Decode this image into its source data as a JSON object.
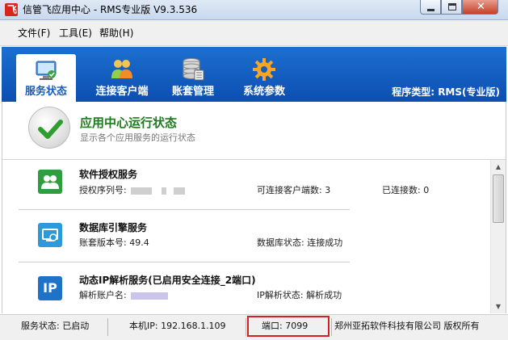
{
  "window": {
    "title": "信管飞应用中心 - RMS专业版 V9.3.536",
    "icon": "app-logo-icon",
    "close_label": "✕"
  },
  "menu": [
    {
      "label": "文件(F)"
    },
    {
      "label": "工具(E)"
    },
    {
      "label": "帮助(H)"
    }
  ],
  "nav": {
    "tabs": [
      {
        "label": "服务状态",
        "icon": "monitor-icon",
        "active": true
      },
      {
        "label": "连接客户端",
        "icon": "users-icon",
        "active": false
      },
      {
        "label": "账套管理",
        "icon": "database-icon",
        "active": false
      },
      {
        "label": "系统参数",
        "icon": "gear-icon",
        "active": false
      }
    ],
    "program_type": "程序类型: RMS(专业版)"
  },
  "header": {
    "title": "应用中心运行状态",
    "subtitle": "显示各个应用服务的运行状态"
  },
  "services": [
    {
      "name": "软件授权服务",
      "icon": "users-icon",
      "field1_label": "授权序列号:",
      "field2": "可连接客户端数: 3",
      "field3": "已连接数:  0"
    },
    {
      "name": "数据库引擎服务",
      "icon": "database-engine-icon",
      "field1": "账套版本号: 49.4",
      "field2": "数据库状态: 连接成功"
    },
    {
      "name": "动态IP解析服务(已启用安全连接_2端口)",
      "icon": "ip-icon",
      "icon_text": "IP",
      "field1_label": "解析账户名:",
      "field2": "IP解析状态: 解析成功"
    }
  ],
  "status": {
    "service_state": "服务状态: 已启动",
    "local_ip": "本机IP: 192.168.1.109",
    "port": "端口: 7099",
    "copyright": "郑州亚拓软件科技有限公司 版权所有"
  },
  "colors": {
    "nav_blue": "#0b4fb1",
    "header_green": "#1f7a1f",
    "port_highlight": "#d32020"
  }
}
